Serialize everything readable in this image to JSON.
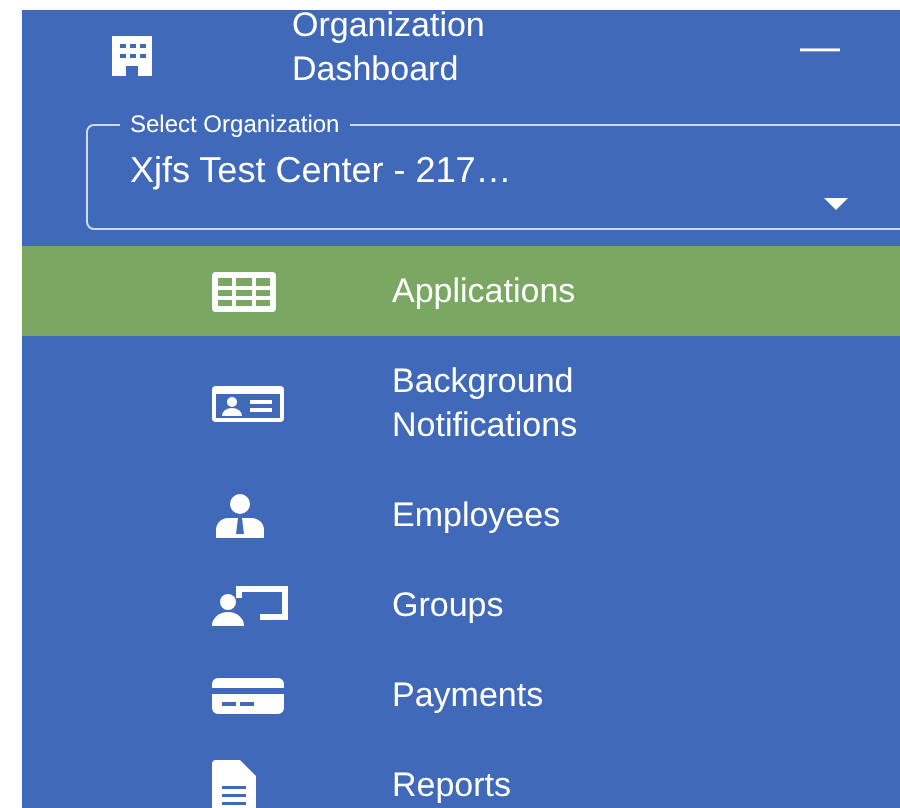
{
  "header": {
    "title": "Organization Dashboard",
    "collapse_symbol": "—"
  },
  "organization_select": {
    "label": "Select Organization",
    "value": "Xjfs Test Center - 217…"
  },
  "nav_items": [
    {
      "label": "Applications",
      "selected": true
    },
    {
      "label": "Background Notifications",
      "selected": false
    },
    {
      "label": "Employees",
      "selected": false
    },
    {
      "label": "Groups",
      "selected": false
    },
    {
      "label": "Payments",
      "selected": false
    },
    {
      "label": "Reports",
      "selected": false
    }
  ]
}
